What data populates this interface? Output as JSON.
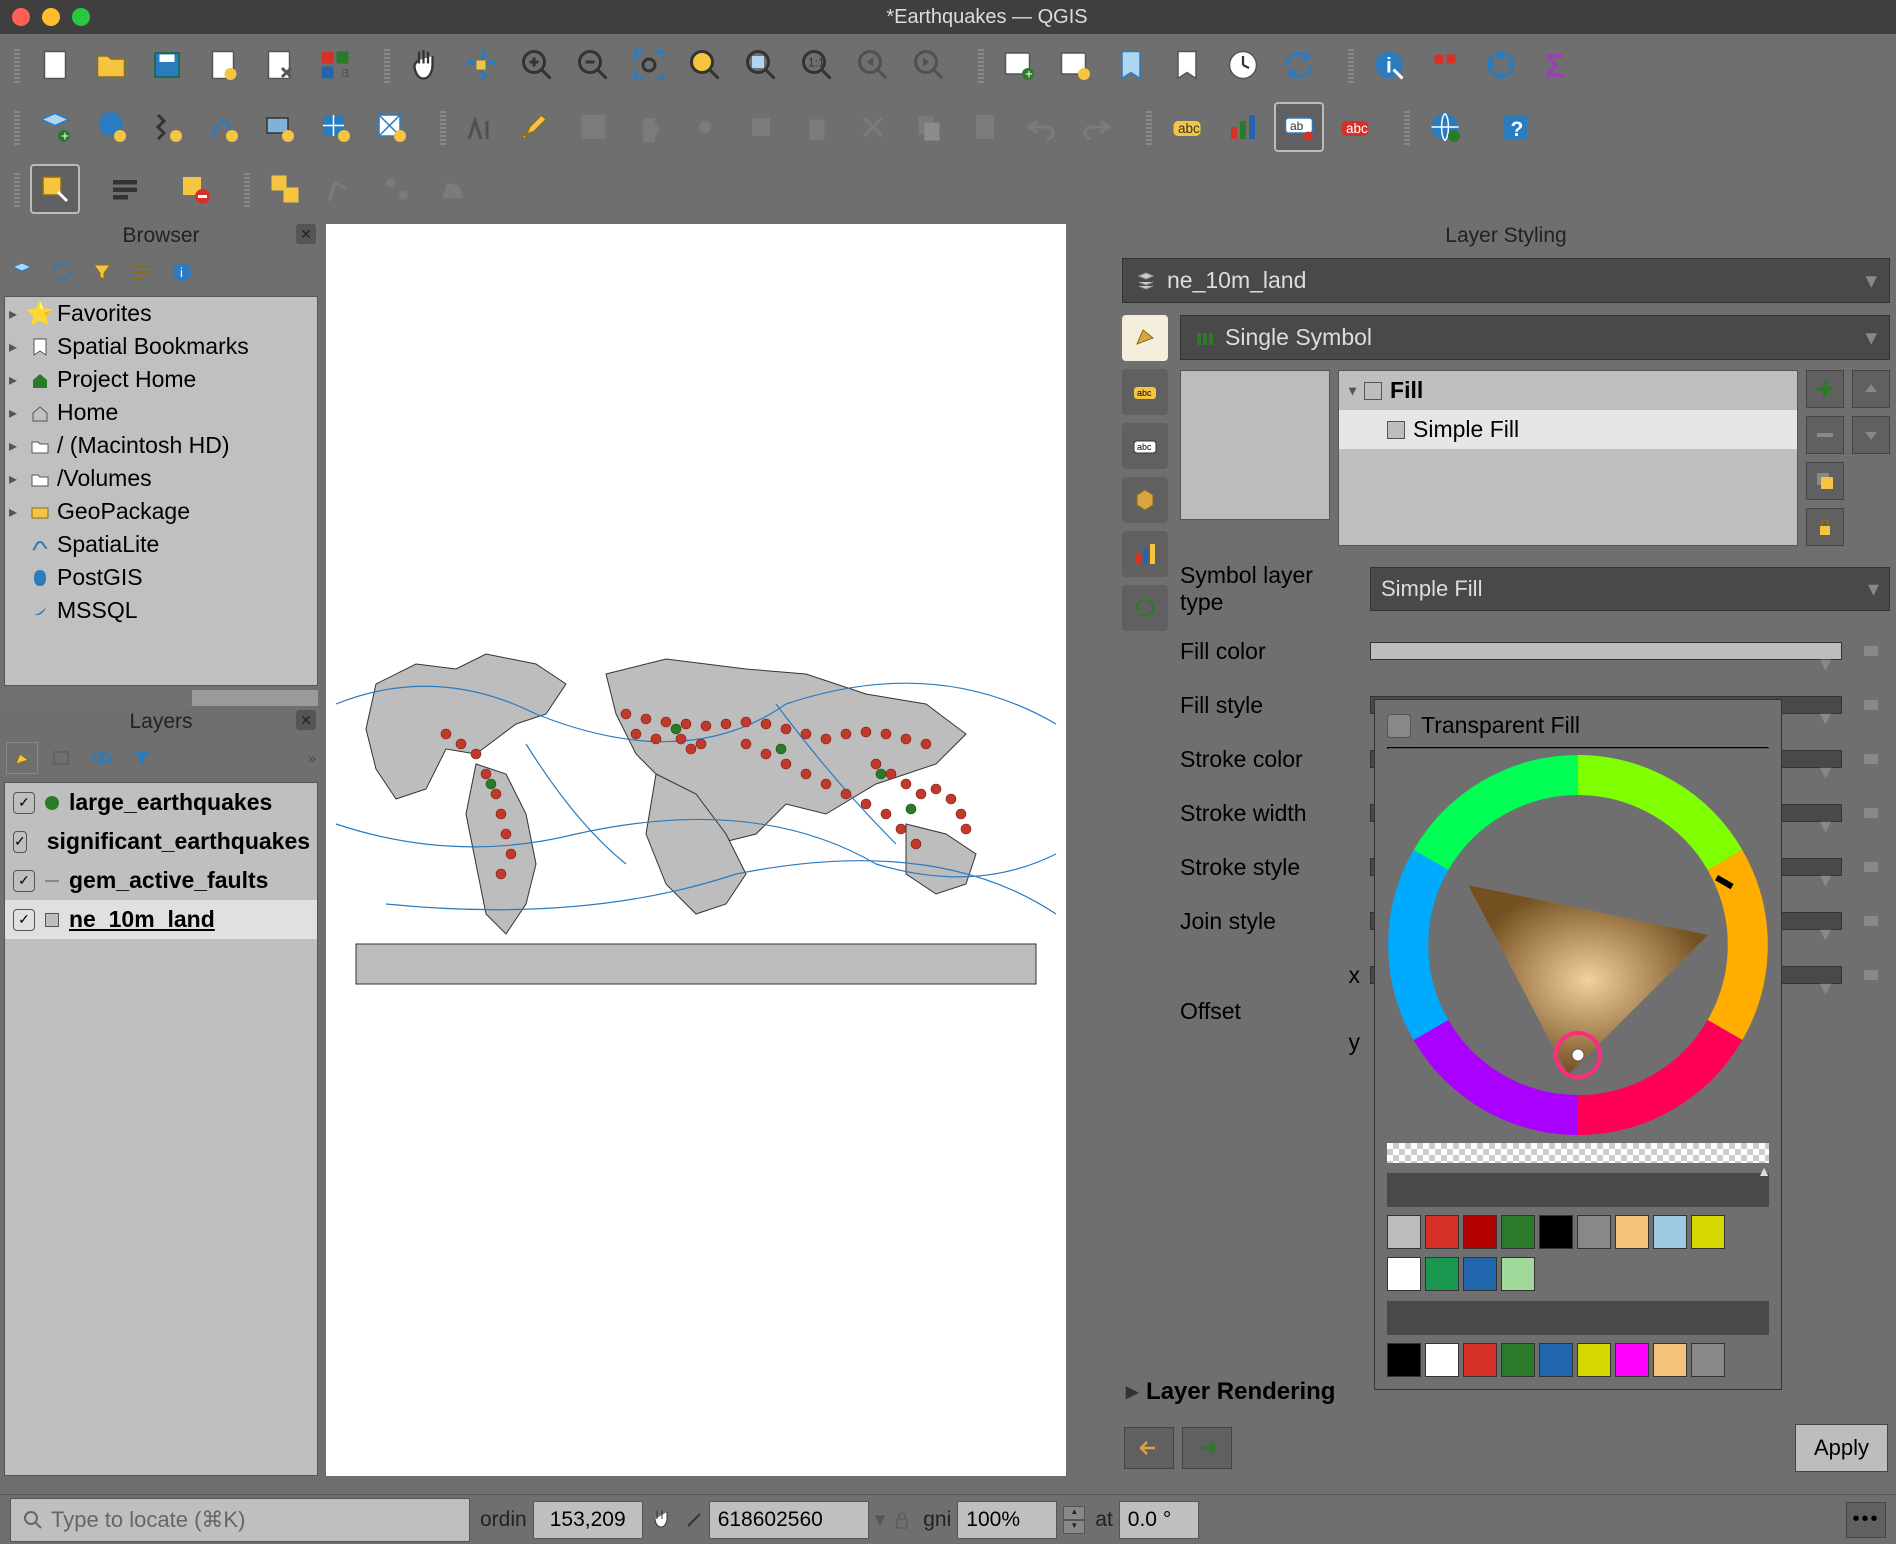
{
  "window": {
    "title": "*Earthquakes — QGIS"
  },
  "panels": {
    "browser": {
      "title": "Browser",
      "items": [
        {
          "label": "Favorites",
          "icon": "star"
        },
        {
          "label": "Spatial Bookmarks",
          "icon": "bookmark"
        },
        {
          "label": "Project Home",
          "icon": "home-map"
        },
        {
          "label": "Home",
          "icon": "home"
        },
        {
          "label": "/ (Macintosh HD)",
          "icon": "folder"
        },
        {
          "label": "/Volumes",
          "icon": "folder"
        },
        {
          "label": "GeoPackage",
          "icon": "geopackage"
        },
        {
          "label": "SpatiaLite",
          "icon": "spatialite"
        },
        {
          "label": "PostGIS",
          "icon": "postgis"
        },
        {
          "label": "MSSQL",
          "icon": "mssql"
        }
      ]
    },
    "layers": {
      "title": "Layers",
      "items": [
        {
          "name": "large_earthquakes",
          "checked": true,
          "color": "#2a7a2a",
          "style": "point"
        },
        {
          "name": "significant_earthquakes",
          "checked": true,
          "color": "#c0392b",
          "style": "point"
        },
        {
          "name": "gem_active_faults",
          "checked": true,
          "color": "#888",
          "style": "line"
        },
        {
          "name": "ne_10m_land",
          "checked": true,
          "color": "#bdbdbd",
          "style": "fill",
          "selected": true
        }
      ]
    }
  },
  "styling": {
    "title": "Layer Styling",
    "current_layer": "ne_10m_land",
    "symbol_type": "Single Symbol",
    "fill_tree": {
      "root": "Fill",
      "child": "Simple Fill"
    },
    "symbol_layer_type_label": "Symbol layer type",
    "symbol_layer_type_value": "Simple Fill",
    "props": {
      "fill_color": "Fill color",
      "fill_style": "Fill style",
      "stroke_color": "Stroke color",
      "stroke_width": "Stroke width",
      "stroke_style": "Stroke style",
      "join_style": "Join style",
      "offset": "Offset",
      "offset_x": "x",
      "offset_y": "y"
    },
    "layer_rendering": "Layer Rendering",
    "apply": "Apply"
  },
  "color_popup": {
    "transparent_label": "Transparent Fill",
    "swatches1": [
      "#bdbdbd",
      "#d73027",
      "#b30000",
      "#2a7a2a",
      "#000000",
      "#888888",
      "#f4c27a",
      "#9ecae1",
      "#d6d600"
    ],
    "swatches2": [
      "#ffffff",
      "#1a9850",
      "#2166ac",
      "#a1d99b"
    ],
    "swatches3": [
      "#000000",
      "#ffffff",
      "#d73027",
      "#2a7a2a",
      "#2166ac",
      "#d6d600",
      "#ff00ff",
      "#f4c27a",
      "#888888"
    ]
  },
  "statusbar": {
    "search_placeholder": "Type to locate (⌘K)",
    "coord_label": "ordin",
    "coord_value": "153,209",
    "scale_value": "618602560",
    "magnifier_label": "gni",
    "magnifier_value": "100%",
    "rotation_label": "at",
    "rotation_value": "0.0 °"
  }
}
